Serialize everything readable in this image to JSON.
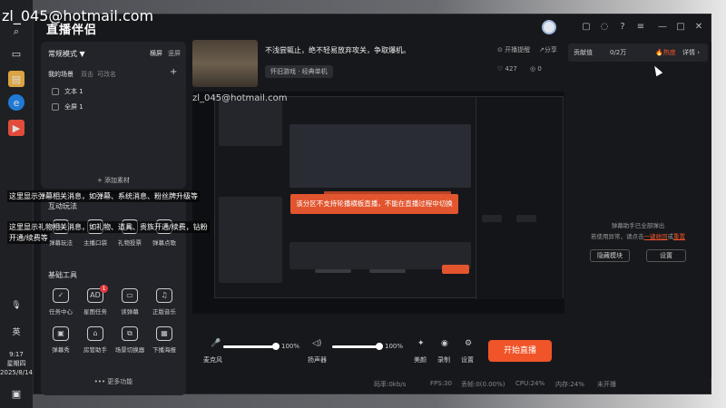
{
  "watermark": "zl_045@hotmail.com",
  "taskbar": {
    "ime": "英",
    "time": "9:17",
    "weekday": "星期四",
    "date": "2025/8/14"
  },
  "app": {
    "logo": "直播伴侣",
    "left": {
      "mode": "常规模式 ▼",
      "orient_h": "横屏",
      "orient_v": "竖屏",
      "scene_tab_mine": "我的场景",
      "scene_tab_two": "双击",
      "scene_tab_edit": "可改名",
      "scene_add": "+",
      "scenes": [
        "文本 1",
        "全屏 1"
      ],
      "add_material": "+ 添加素材",
      "interactive_title": "互动玩法",
      "interactive_tools": [
        "弹幕玩法",
        "主播口袋",
        "礼物投票",
        "弹幕点歌"
      ],
      "basic_title": "基础工具",
      "basic_tools": [
        "任务中心",
        "星图任务",
        "读弹幕",
        "正版音乐",
        "弹幕秀",
        "房管助手",
        "场景切换器",
        "下播海报"
      ],
      "basic_badge": "1",
      "more": "••• 更多功能"
    },
    "stream": {
      "title": "不浅尝辄止，绝不轻易放弃攻关，争取爆机。",
      "category": "怀旧游戏 · 经典单机",
      "end_reminder": "开播提醒",
      "share": "分享",
      "likes": "427",
      "viewers": "0"
    },
    "preview": {
      "warning": "该分区不支持轮播横板直播，不能在直播过程中切换",
      "inner_warning": "该分区不支持轮播横板直播"
    },
    "controls": {
      "mic_label": "麦克风",
      "mic_value": "100%",
      "speaker_label": "扬声器",
      "speaker_value": "100%",
      "beauty": "美颜",
      "record": "录制",
      "settings": "设置",
      "start": "开始直播"
    },
    "status": {
      "bitrate": "码率:0kb/s",
      "fps": "FPS:30",
      "dropped": "丢帧:0(0.00%)",
      "cpu": "CPU:24%",
      "mem": "内存:24%",
      "net": "未开播"
    },
    "right": {
      "contrib_label": "贡献值",
      "contrib_value": "0/2万",
      "hot": "🔥热度",
      "detail": "详情 ›",
      "hint1": "弹幕助手已全部弹出",
      "hint2_a": "若使用异常，请点击",
      "hint2_link1": "一键收回",
      "hint2_or": "或",
      "hint2_link2": "重置",
      "hide_btn": "隐藏模块",
      "settings_btn": "设置"
    }
  },
  "overlay": {
    "line1": "这里显示弹幕相关消息，如弹幕、系统消息、粉丝牌升级等",
    "line2": "这里显示礼物相关消息，如礼物、道具、贵族开通/续费，钻粉",
    "line3": "开通/续费等"
  },
  "colors": {
    "accent": "#f05428",
    "warning": "#e2552e",
    "badge": "#e5393d"
  }
}
